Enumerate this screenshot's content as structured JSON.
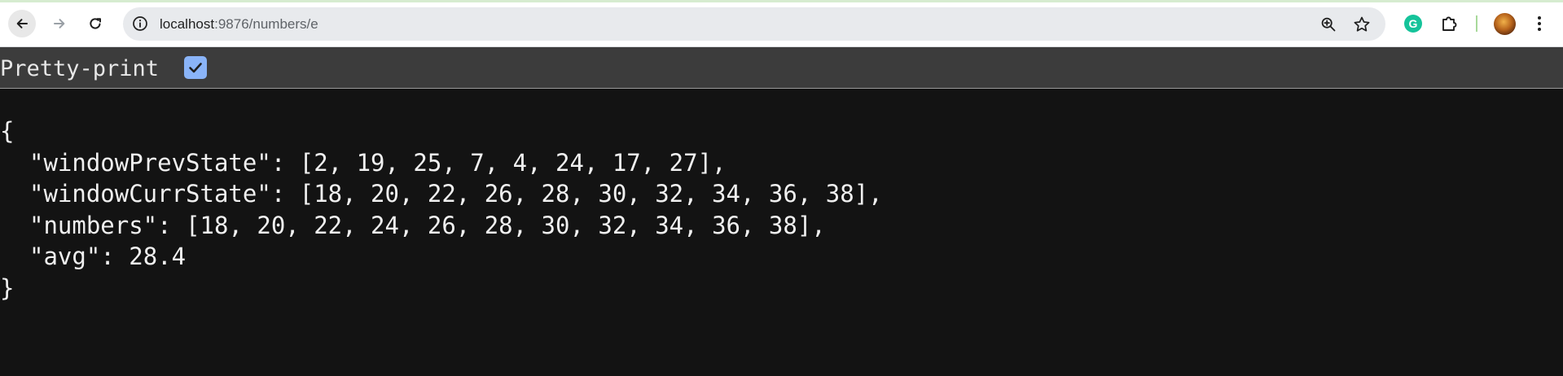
{
  "browser": {
    "url_host": "localhost",
    "url_rest": ":9876/numbers/e",
    "icons": {
      "back": "arrow-left-icon",
      "forward": "arrow-right-icon",
      "reload": "reload-icon",
      "site_info": "info-icon",
      "zoom": "zoom-icon",
      "bookmark": "star-icon",
      "grammarly": "grammarly-icon",
      "extensions": "puzzle-icon",
      "menu": "kebab-menu-icon"
    },
    "grammarly_letter": "G"
  },
  "viewer": {
    "pretty_print_label": "Pretty-print",
    "pretty_print_checked": true
  },
  "json_text": {
    "open_brace": "{",
    "line1_key": "\"windowPrevState\"",
    "line1_value": "[2, 19, 25, 7, 4, 24, 17, 27],",
    "line2_key": "\"windowCurrState\"",
    "line2_value": "[18, 20, 22, 26, 28, 30, 32, 34, 36, 38],",
    "line3_key": "\"numbers\"",
    "line3_value": "[18, 20, 22, 24, 26, 28, 30, 32, 34, 36, 38],",
    "line4_key": "\"avg\"",
    "line4_value": "28.4",
    "close_brace": "}"
  }
}
